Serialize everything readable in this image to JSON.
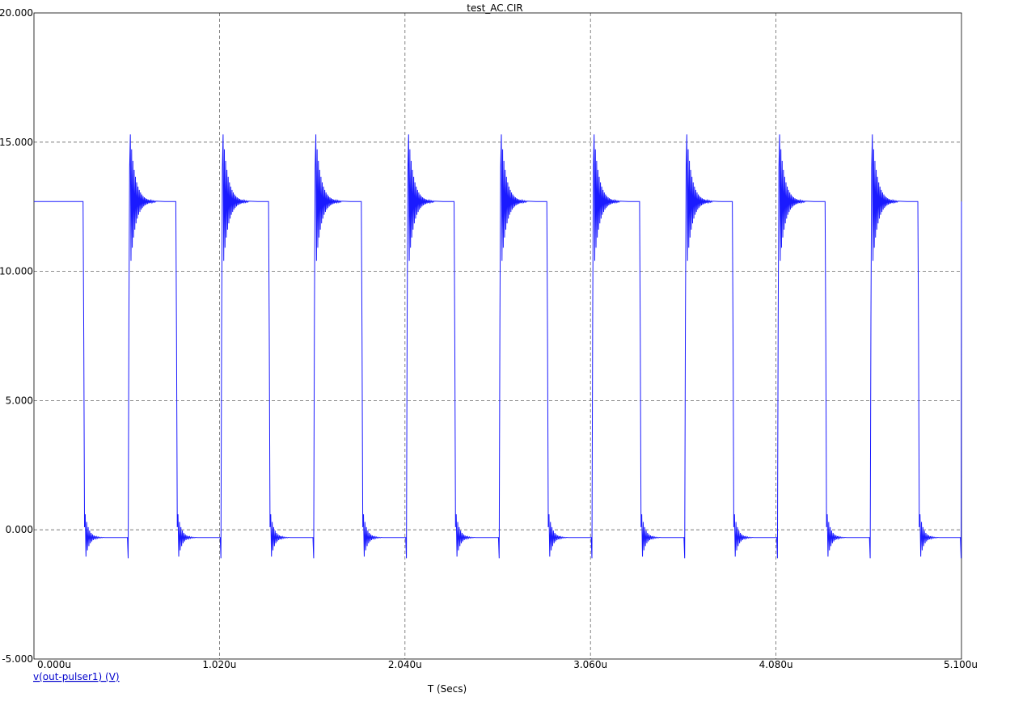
{
  "chart_data": {
    "type": "line",
    "title": "test_AC.CIR",
    "xlabel": "T (Secs)",
    "ylabel": "",
    "xlim": [
      0,
      5.1
    ],
    "ylim": [
      -5,
      20
    ],
    "grid": true,
    "x_ticks": [
      0,
      1.02,
      2.04,
      3.06,
      4.08,
      5.1
    ],
    "x_tick_labels": [
      "0.000u",
      "1.020u",
      "2.040u",
      "3.060u",
      "4.080u",
      "5.100u"
    ],
    "y_ticks": [
      -5,
      0,
      5,
      10,
      15,
      20
    ],
    "y_tick_labels": [
      "-5.000",
      "0.000",
      "5.000",
      "10.000",
      "15.000",
      "20.000"
    ],
    "legend_placement": "bottom-left",
    "series": [
      {
        "name": "v(out-pulser1) (V)",
        "color": "#1a1aff",
        "high_level": 12.7,
        "low_level": -0.3,
        "fall_times": [
          0.27,
          0.78,
          1.29,
          1.8,
          2.31,
          2.82,
          3.33,
          3.84,
          4.35,
          4.86
        ],
        "rise_times": [
          0.52,
          1.03,
          1.54,
          2.05,
          2.56,
          3.07,
          3.58,
          4.09,
          4.6,
          5.1
        ],
        "overshoot_peak": 14.0,
        "undershoot_min": -1.1
      }
    ]
  }
}
